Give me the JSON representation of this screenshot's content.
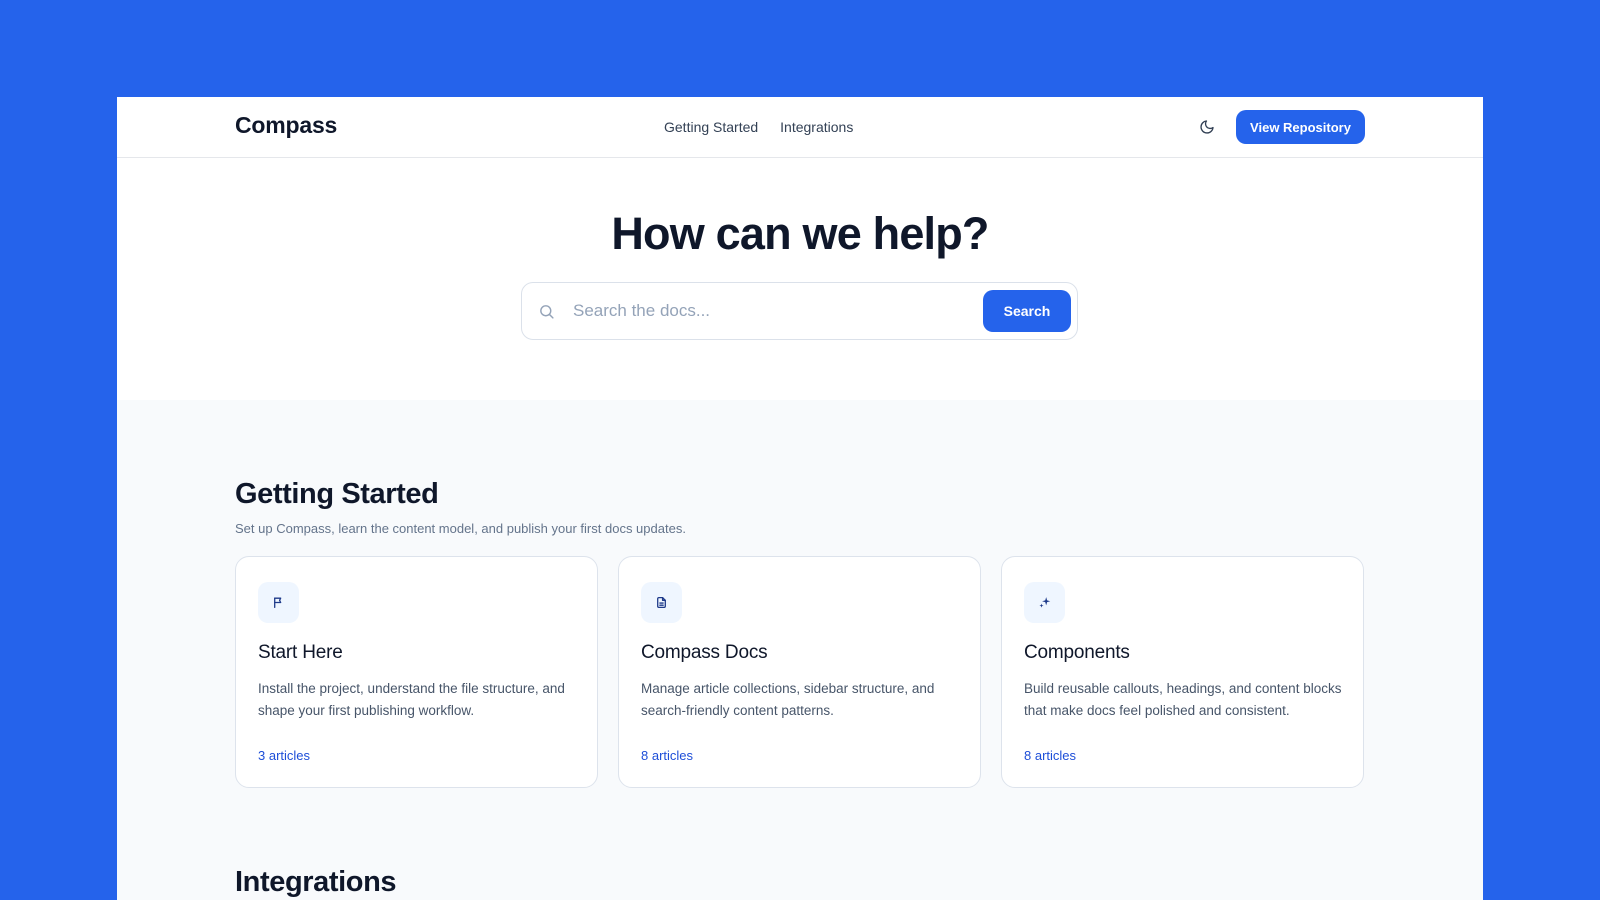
{
  "header": {
    "brand": "Compass",
    "nav": [
      "Getting Started",
      "Integrations"
    ],
    "theme_toggle_icon": "moon-icon",
    "repo_button": "View Repository"
  },
  "hero": {
    "title": "How can we help?",
    "search_placeholder": "Search the docs...",
    "search_value": "",
    "search_button": "Search",
    "search_icon": "search-icon"
  },
  "getting_started": {
    "title": "Getting Started",
    "subtitle": "Set up Compass, learn the content model, and publish your first docs updates.",
    "cards": [
      {
        "icon": "flag-icon",
        "title": "Start Here",
        "description": "Install the project, understand the file structure, and shape your first publishing workflow.",
        "count": "3 articles"
      },
      {
        "icon": "document-icon",
        "title": "Compass Docs",
        "description": "Manage article collections, sidebar structure, and search-friendly content patterns.",
        "count": "8 articles"
      },
      {
        "icon": "sparkle-icon",
        "title": "Components",
        "description": "Build reusable callouts, headings, and content blocks that make docs feel polished and consistent.",
        "count": "8 articles"
      }
    ]
  },
  "integrations": {
    "title": "Integrations"
  },
  "colors": {
    "accent": "#2563eb",
    "background": "#2563eb",
    "text": "#0f172a",
    "muted": "#64748b",
    "link": "#1d4ed8"
  }
}
